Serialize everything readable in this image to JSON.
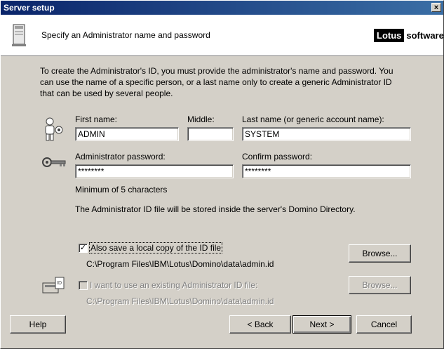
{
  "window": {
    "title": "Server setup",
    "close_label": "×"
  },
  "header": {
    "subtitle": "Specify an Administrator name and password",
    "logo_brand": "Lotus",
    "logo_word": "software"
  },
  "intro": "To create the Administrator's ID, you must provide the administrator's name and password. You can use the name of a specific person, or a last name only to create a generic Administrator ID that can be used by several people.",
  "name": {
    "first_label": "First name:",
    "first_value": "ADMIN",
    "middle_label": "Middle:",
    "middle_value": "",
    "last_label": "Last name (or generic account name):",
    "last_value": "SYSTEM"
  },
  "password": {
    "admin_label": "Administrator password:",
    "admin_value": "********",
    "confirm_label": "Confirm password:",
    "confirm_value": "********",
    "hint": "Minimum of 5 characters"
  },
  "storage_note": "The Administrator ID file will be stored inside the server's Domino Directory.",
  "local_copy": {
    "label": "Also save a local copy of the ID file",
    "checked": true,
    "path": "C:\\Program Files\\IBM\\Lotus\\Domino\\data\\admin.id",
    "browse": "Browse..."
  },
  "existing_id": {
    "label": "I want to use an existing Administrator ID file:",
    "checked": false,
    "path": "C:\\Program Files\\IBM\\Lotus\\Domino\\data\\admin.id",
    "browse": "Browse..."
  },
  "buttons": {
    "help": "Help",
    "back": "< Back",
    "next": "Next >",
    "cancel": "Cancel"
  },
  "icons": [
    "server-doc-icon",
    "person-icon",
    "key-icon",
    "id-card-icon"
  ]
}
